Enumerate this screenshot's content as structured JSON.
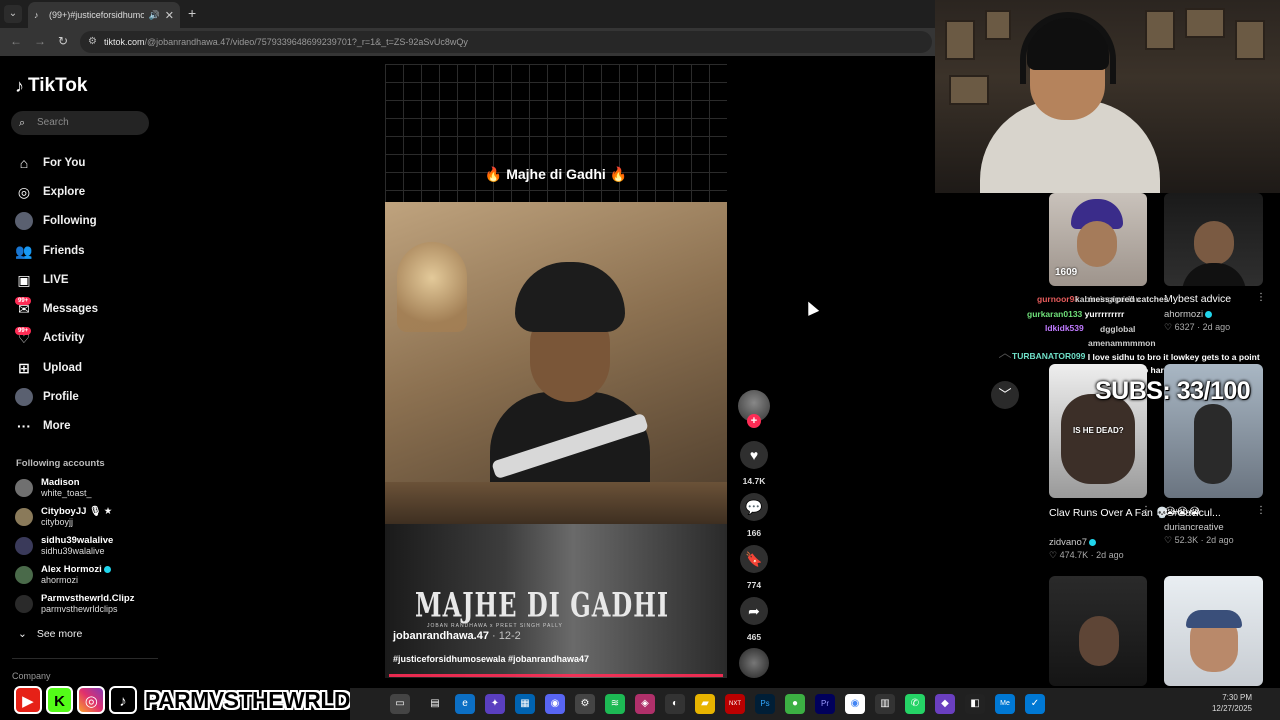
{
  "browser": {
    "tab_title": "(99+)#justiceforsidhumose...",
    "address_host": "tiktok.com",
    "address_path": "/@jobanrandhawa.47/video/7579339648699239701?_r=1&_t=ZS-92aSvUc8wQy"
  },
  "sidebar": {
    "logo": "TikTok",
    "search_placeholder": "Search",
    "nav": [
      {
        "label": "For You",
        "icon": "home-icon"
      },
      {
        "label": "Explore",
        "icon": "compass-icon"
      },
      {
        "label": "Following",
        "icon": "avatar-icon"
      },
      {
        "label": "Friends",
        "icon": "friends-icon"
      },
      {
        "label": "LIVE",
        "icon": "live-icon"
      },
      {
        "label": "Messages",
        "icon": "messages-icon",
        "badge": "99+"
      },
      {
        "label": "Activity",
        "icon": "activity-icon",
        "badge": "99+"
      },
      {
        "label": "Upload",
        "icon": "upload-icon"
      },
      {
        "label": "Profile",
        "icon": "profile-icon"
      },
      {
        "label": "More",
        "icon": "more-icon"
      }
    ],
    "following_title": "Following accounts",
    "following": [
      {
        "name": "Madison",
        "handle": "white_toast_"
      },
      {
        "name": "CityboyJJ 🎙 ★",
        "handle": "cityboyjj"
      },
      {
        "name": "sidhu39walalive",
        "handle": "sidhu39walalive"
      },
      {
        "name": "Alex Hormozi",
        "handle": "ahormozi",
        "verified": true
      },
      {
        "name": "Parmvsthewrld.Clipz",
        "handle": "parmvsthewrldclips"
      }
    ],
    "see_more": "See more",
    "company": "Company"
  },
  "video": {
    "title": "🔥 Majhe di Gadhi 🔥",
    "poster_title": "MAJHE DI GADHI",
    "poster_sub": "JOBAN RANDHAWA x PREET SINGH PALLY",
    "author": "jobanrandhawa.47",
    "date": "· 12-2",
    "hashtags": "#justiceforsidhumosewala #jobanrandhawa47",
    "likes": "14.7K",
    "comments": "166",
    "saves": "774",
    "shares": "465"
  },
  "feed": [
    {
      "caption": "Mybest advice",
      "author": "ahormozi",
      "verified": true,
      "likes": "6327",
      "age": "2d ago"
    },
    {
      "caption": "Clav Runs Over A Fan 💀 #clavicul...",
      "author": "zidvano7",
      "verified": true,
      "likes": "474.7K",
      "age": "2d ago",
      "overlay": "IS HE DEAD?"
    },
    {
      "caption": "😭😭😭",
      "author": "duriancreative",
      "likes": "52.3K",
      "age": "2d ago"
    }
  ],
  "thumb_text": {
    "views": "1609"
  },
  "chat": [
    {
      "user": "gurkaran0133",
      "msg": "yurrrrrrrrr",
      "color": "#6fe07a"
    },
    {
      "user": "ldkidk539",
      "msg": "",
      "color": "#c07aff"
    },
    {
      "user": "TURBANATOR099",
      "msg": "I love sidhu to bro it lowkey gets to a point bros galzing to hard",
      "color": "#6fe0c8"
    }
  ],
  "chat_misc": [
    "gurnoor98",
    "kabirsinghsidhu",
    "message",
    "pred catches",
    "dgglobal",
    "amenammmmon"
  ],
  "subs": "SUBS: 33/100",
  "stream": {
    "handle": "PARMVSTHEWRLD"
  },
  "clock": {
    "time": "7:30 PM",
    "date": "12/27/2025"
  },
  "colors": {
    "accent": "#fe2c55",
    "verified": "#20d5ec"
  }
}
